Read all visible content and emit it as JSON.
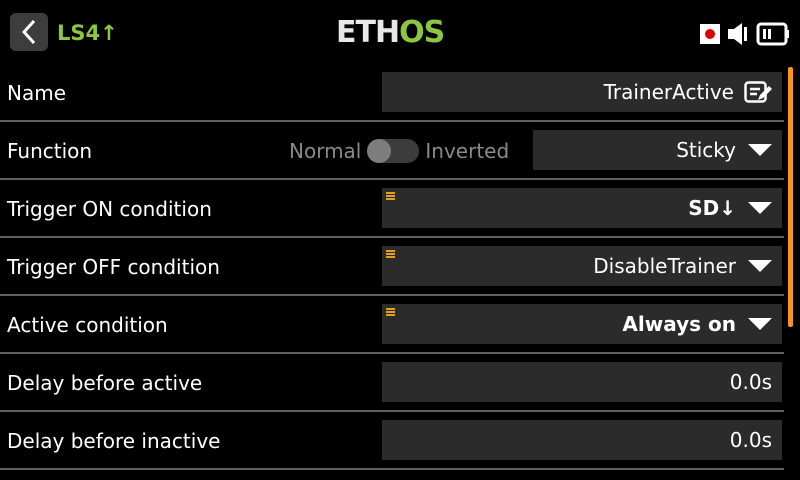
{
  "header": {
    "page_id": "LS4↑",
    "logo_eth": "ETH",
    "logo_os": "OS"
  },
  "colors": {
    "accent_green": "#8cc63f",
    "scrollbar_orange": "#f7941d",
    "record_red": "#e00000",
    "field_bg": "#2b2b2b"
  },
  "rows": {
    "name": {
      "label": "Name",
      "value": "TrainerActive"
    },
    "function": {
      "label": "Function",
      "toggle_left": "Normal",
      "toggle_right": "Inverted",
      "toggle_state": "Normal",
      "value": "Sticky"
    },
    "trigger_on": {
      "label": "Trigger ON condition",
      "value": "SD↓"
    },
    "trigger_off": {
      "label": "Trigger OFF condition",
      "value": "DisableTrainer"
    },
    "active": {
      "label": "Active condition",
      "value": "Always on"
    },
    "delay_active": {
      "label": "Delay before active",
      "value": "0.0s"
    },
    "delay_inactive": {
      "label": "Delay before inactive",
      "value": "0.0s"
    }
  },
  "icons": {
    "back": "chevron-left-icon",
    "record": "record-icon",
    "speaker": "speaker-icon",
    "battery": "battery-icon",
    "edit": "edit-icon",
    "dropdown": "caret-down-icon",
    "condition_menu": "lines-menu-icon"
  }
}
